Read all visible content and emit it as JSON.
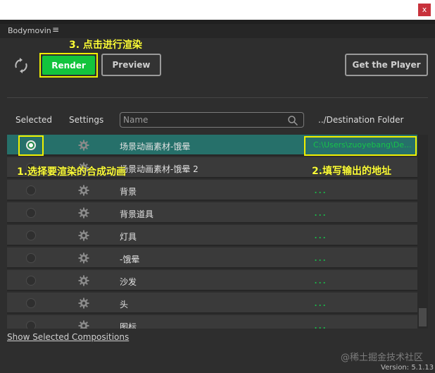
{
  "window": {
    "close_label": "x"
  },
  "menu": {
    "app_name": "Bodymovin",
    "menu_icon": "≡"
  },
  "toolbar": {
    "render_label": "Render",
    "preview_label": "Preview",
    "get_player_label": "Get the Player"
  },
  "table": {
    "col_selected": "Selected",
    "col_settings": "Settings",
    "name_placeholder": "Name",
    "col_destination": "../Destination Folder"
  },
  "rows": [
    {
      "name": "场景动画素材-饿晕",
      "destination": "C:\\Users\\zuoyebang\\De...",
      "selected": true
    },
    {
      "name": "场景动画素材-饿晕 2",
      "destination": "...",
      "selected": false
    },
    {
      "name": "背景",
      "destination": "...",
      "selected": false
    },
    {
      "name": "背景道具",
      "destination": "...",
      "selected": false
    },
    {
      "name": "灯具",
      "destination": "...",
      "selected": false
    },
    {
      "name": "-饿晕",
      "destination": "...",
      "selected": false
    },
    {
      "name": "沙发",
      "destination": "...",
      "selected": false
    },
    {
      "name": "头",
      "destination": "...",
      "selected": false
    },
    {
      "name": "图标",
      "destination": "...",
      "selected": false
    }
  ],
  "annotations": {
    "step1": "1.选择要渲染的合成动画",
    "step2": "2.填写输出的地址",
    "step3": "3. 点击进行渲染"
  },
  "footer": {
    "show_selected": "Show Selected Compositions",
    "watermark": "@稀土掘金技术社区",
    "version": "Version: 5.1.13"
  },
  "colors": {
    "accent_green": "#13c43d",
    "highlight_yellow": "#f0f000",
    "selected_row": "#26706a"
  }
}
